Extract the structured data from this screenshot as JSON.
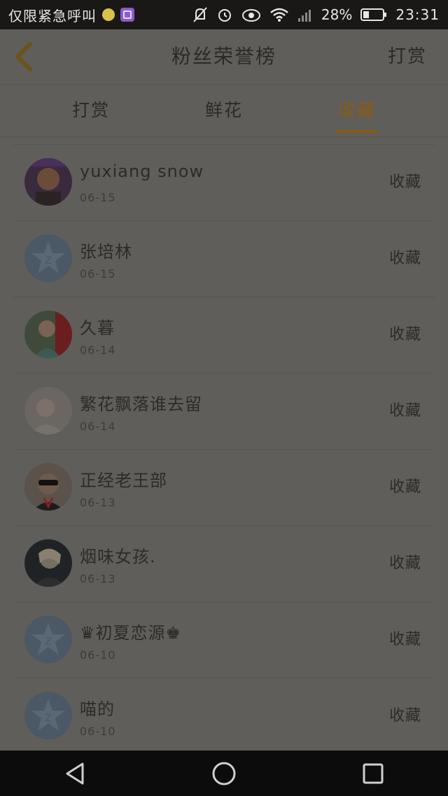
{
  "status_bar": {
    "carrier": "仅限紧急呼叫",
    "battery_pct": "28%",
    "time": "23:31"
  },
  "header": {
    "title": "粉丝荣誉榜",
    "action": "打赏"
  },
  "tabs": [
    {
      "label": "打赏",
      "active": false
    },
    {
      "label": "鲜花",
      "active": false
    },
    {
      "label": "收藏",
      "active": true
    }
  ],
  "rows": [
    {
      "name": "yuxiang snow",
      "date": "06-15",
      "action": "收藏",
      "avatar": "photo-man"
    },
    {
      "name": "张培林",
      "date": "06-15",
      "action": "收藏",
      "avatar": "default-star"
    },
    {
      "name": "久暮",
      "date": "06-14",
      "action": "收藏",
      "avatar": "photo-woman-red"
    },
    {
      "name": "繁花飘落谁去留",
      "date": "06-14",
      "action": "收藏",
      "avatar": "photo-woman-light"
    },
    {
      "name": "正经老王部",
      "date": "06-13",
      "action": "收藏",
      "avatar": "photo-sunglasses"
    },
    {
      "name": "烟味女孩.",
      "date": "06-13",
      "action": "收藏",
      "avatar": "photo-blonde"
    },
    {
      "name": "♛初夏恋源♚",
      "date": "06-10",
      "action": "收藏",
      "avatar": "default-star"
    },
    {
      "name": "喵的",
      "date": "06-10",
      "action": "收藏",
      "avatar": "default-star"
    }
  ],
  "colors": {
    "accent": "#8a5c12",
    "background": "#5f5e5b"
  }
}
